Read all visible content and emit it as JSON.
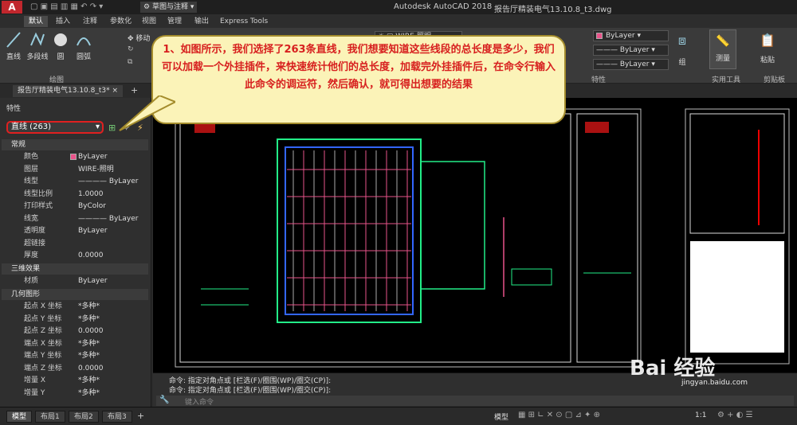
{
  "titlebar": {
    "workspace": "草图与注释",
    "app_title": "Autodesk AutoCAD 2018",
    "file_title": "报告厅精装电气13.10.8_t3.dwg"
  },
  "ribbon_tabs": [
    "默认",
    "插入",
    "注释",
    "参数化",
    "视图",
    "管理",
    "输出",
    "Express Tools"
  ],
  "ribbon": {
    "draw_tools": [
      "直线",
      "多段线",
      "圆",
      "圆弧"
    ],
    "draw_panel": "绘图",
    "move_label": "移动",
    "layer_name": "WIRE-照明",
    "properties_panel": "特性",
    "color_value": "ByLayer",
    "linetype_value": "ByLayer",
    "lineweight_value": "ByLayer",
    "group_label": "组",
    "measure_label": "测量",
    "paste_label": "粘贴",
    "utilities_panel": "实用工具",
    "clipboard_panel": "剪贴板",
    "color_accent": "#e9538a"
  },
  "doc_tab": "报告厅精装电气13.10.8_t3*",
  "properties": {
    "panel_title": "特性",
    "selection": "直线 (263)",
    "sections": {
      "general": "常规",
      "threed": "三维效果",
      "geometry": "几何图形"
    },
    "general_rows": [
      {
        "k": "颜色",
        "v": "ByLayer"
      },
      {
        "k": "图层",
        "v": "WIRE-照明"
      },
      {
        "k": "线型",
        "v": "———— ByLayer"
      },
      {
        "k": "线型比例",
        "v": "1.0000"
      },
      {
        "k": "打印样式",
        "v": "ByColor"
      },
      {
        "k": "线宽",
        "v": "———— ByLayer"
      },
      {
        "k": "透明度",
        "v": "ByLayer"
      },
      {
        "k": "超链接",
        "v": ""
      },
      {
        "k": "厚度",
        "v": "0.0000"
      }
    ],
    "threed_rows": [
      {
        "k": "材质",
        "v": "ByLayer"
      }
    ],
    "geometry_rows": [
      {
        "k": "起点 X 坐标",
        "v": "*多种*"
      },
      {
        "k": "起点 Y 坐标",
        "v": "*多种*"
      },
      {
        "k": "起点 Z 坐标",
        "v": "0.0000"
      },
      {
        "k": "端点 X 坐标",
        "v": "*多种*"
      },
      {
        "k": "端点 Y 坐标",
        "v": "*多种*"
      },
      {
        "k": "端点 Z 坐标",
        "v": "0.0000"
      },
      {
        "k": "增量 X",
        "v": "*多种*"
      },
      {
        "k": "增量 Y",
        "v": "*多种*"
      }
    ]
  },
  "callout": "1、如图所示，我们选择了263条直线，我们想要知道这些线段的总长度是多少，我们可以加载一个外挂插件，来快速统计他们的总长度，加载完外挂插件后，在命令行输入此命令的调运符，然后确认，就可得出想要的结果",
  "command": {
    "history": [
      "命令: 指定对角点或 [栏选(F)/圈围(WP)/圈交(CP)]:",
      "命令: 指定对角点或 [栏选(F)/圈围(WP)/圈交(CP)]:"
    ],
    "placeholder": "键入命令"
  },
  "status": {
    "layout_tabs": [
      "模型",
      "布局1",
      "布局2",
      "布局3"
    ],
    "model_label": "模型",
    "scale": "1:1"
  },
  "watermark": {
    "brand": "Bai 经验",
    "url": "jingyan.baidu.com"
  }
}
